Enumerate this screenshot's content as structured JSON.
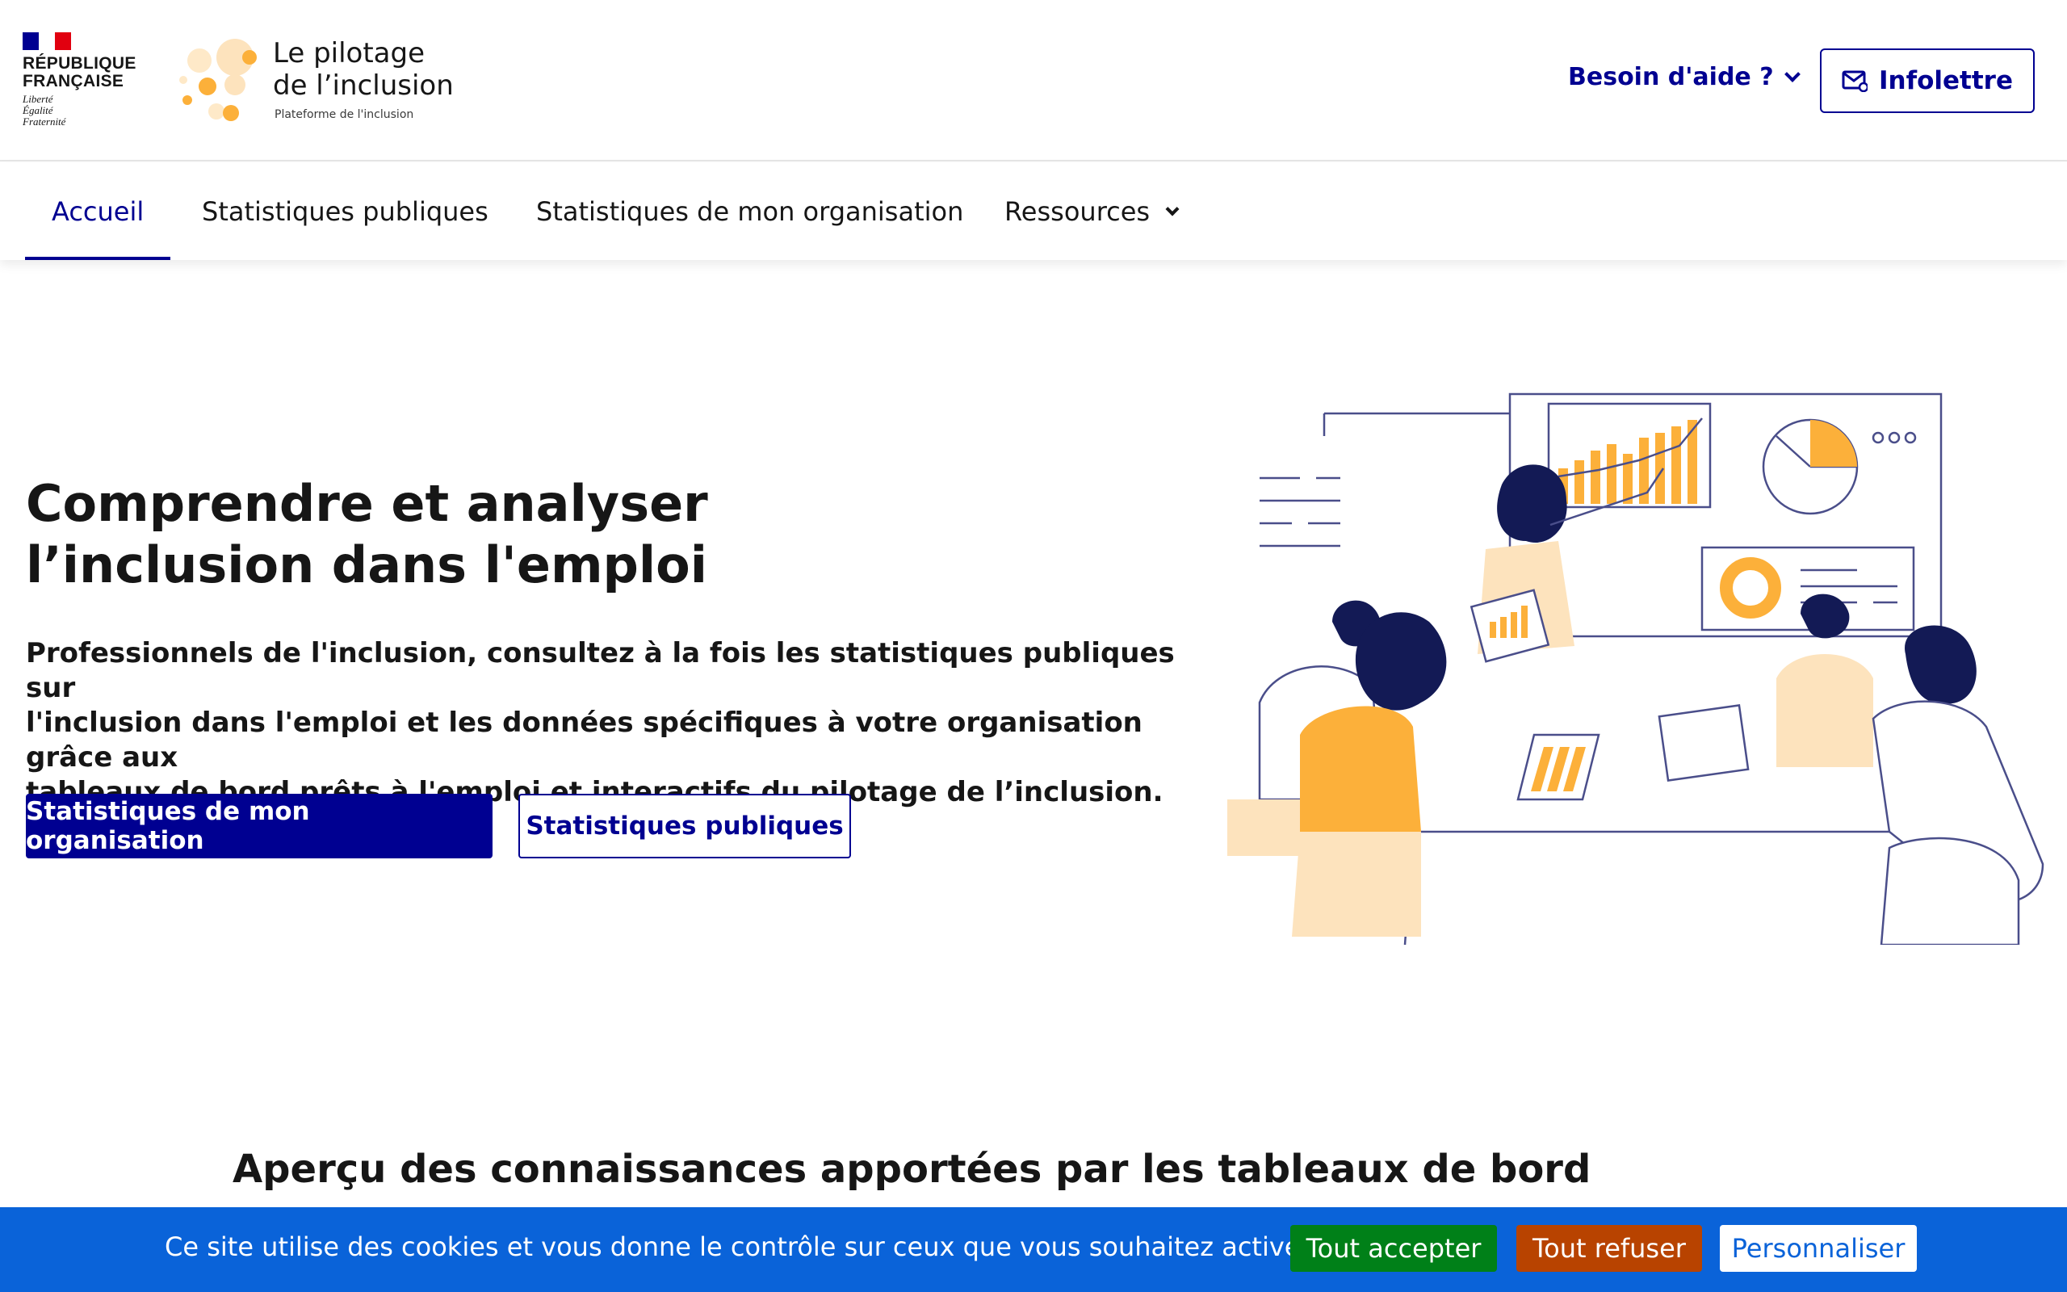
{
  "header": {
    "republic_name_line1": "RÉPUBLIQUE",
    "republic_name_line2": "FRANÇAISE",
    "motto_line1": "Liberté",
    "motto_line2": "Égalité",
    "motto_line3": "Fraternité",
    "brand_title_line1": "Le pilotage",
    "brand_title_line2": "de l’inclusion",
    "brand_subtitle": "Plateforme de l'inclusion",
    "help_label": "Besoin d'aide ?",
    "newsletter_label": "Infolettre",
    "icons": {
      "flag": "french-flag-icon",
      "help_chevron": "chevron-down-icon",
      "newsletter": "envelope-icon"
    }
  },
  "nav": {
    "items": [
      {
        "label": "Accueil",
        "active": true
      },
      {
        "label": "Statistiques publiques",
        "active": false
      },
      {
        "label": "Statistiques de mon organisation",
        "active": false
      },
      {
        "label": "Ressources",
        "active": false,
        "has_dropdown": true
      }
    ]
  },
  "hero": {
    "title_line1": "Comprendre et analyser",
    "title_line2": "l’inclusion dans l'emploi",
    "description_line1": "Professionnels de l'inclusion, consultez à la fois les statistiques publiques sur",
    "description_line2": "l'inclusion dans l'emploi et les données spécifiques à votre organisation grâce aux",
    "description_line3": "tableaux de bord prêts à l'emploi et interactifs du pilotage de l’inclusion.",
    "primary_button": "Statistiques de mon organisation",
    "secondary_button": "Statistiques publiques"
  },
  "section": {
    "title": "Aperçu des connaissances apportées par les tableaux de bord"
  },
  "cookie_banner": {
    "text": "Ce site utilise des cookies et vous donne le contrôle sur ceux que vous souhaitez activer",
    "accept_label": "Tout accepter",
    "refuse_label": "Tout refuser",
    "customize_label": "Personnaliser"
  },
  "colors": {
    "primary": "#000091",
    "accent_orange": "#fcb03a",
    "cookie_bg": "#0a63d9",
    "accept": "#008018",
    "refuse": "#b84300"
  }
}
